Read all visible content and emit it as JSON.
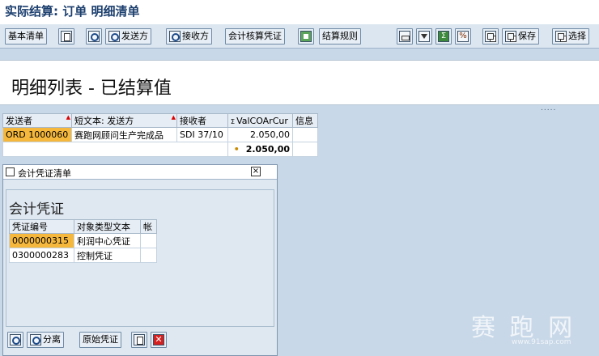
{
  "window": {
    "title": "实际结算: 订单 明细清单"
  },
  "toolbar": {
    "basic_list": "基本清单",
    "sender": "发送方",
    "receiver": "接收方",
    "accounting_doc": "会计核算凭证",
    "settlement_rule": "结算规则",
    "save": "保存",
    "select": "选择"
  },
  "heading": {
    "title": "明细列表  - 已结算值",
    "dots": "....."
  },
  "main_table": {
    "headers": [
      "发送者",
      "短文本: 发送方",
      "接收者",
      "ValCOArCur",
      "信息"
    ],
    "rows": [
      {
        "sender": "ORD 1000060",
        "text": "赛跑网顾问生产完成品",
        "receiver": "SDI 37/10",
        "value": "2.050,00",
        "info": ""
      }
    ],
    "total": "2.050,00",
    "total_marker": "•"
  },
  "dialog": {
    "title": "会计凭证清单",
    "heading": "会计凭证",
    "headers": [
      "凭证编号",
      "对象类型文本",
      "帐"
    ],
    "rows": [
      {
        "doc_no": "0000000315",
        "type_text": "利润中心凭证",
        "acct": ""
      },
      {
        "doc_no": "0300000283",
        "type_text": "控制凭证",
        "acct": ""
      }
    ],
    "buttons": {
      "split": "分离",
      "original_doc": "原始凭证"
    }
  },
  "watermark": {
    "main": "赛 跑 网",
    "sub": "www.91sap.com"
  }
}
